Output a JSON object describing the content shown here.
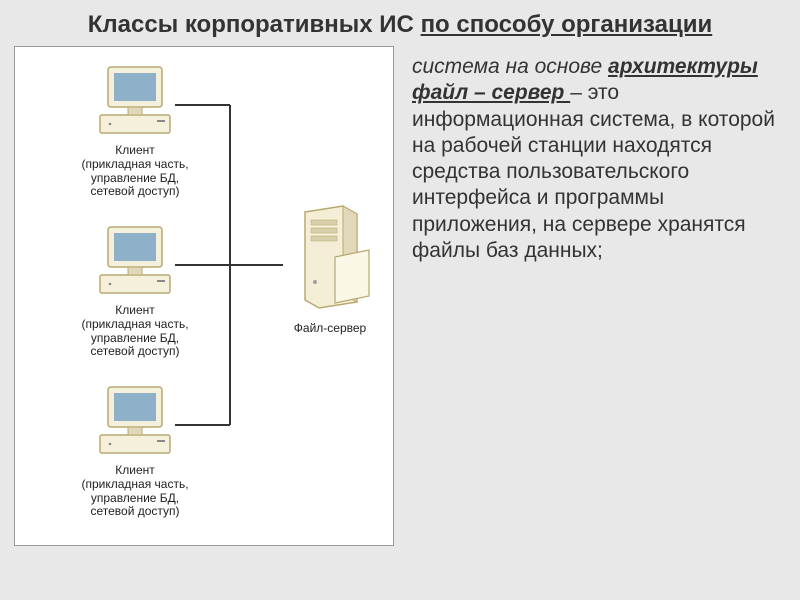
{
  "title": {
    "part1": "Классы корпоративных ИС ",
    "part2_underline": "по способу организации"
  },
  "text": {
    "intro_italic": "система на основе ",
    "arch_bold_underline": "архитектуры файл – сервер ",
    "body": "– это информационная система, в которой на рабочей станции находятся средства пользовательского интерфейса и программы приложения, на сервере хранятся файлы баз данных;"
  },
  "diagram": {
    "clients": [
      {
        "label_line1": "Клиент",
        "label_line2": "(прикладная часть,",
        "label_line3": "управление БД,",
        "label_line4": "сетевой доступ)"
      },
      {
        "label_line1": "Клиент",
        "label_line2": "(прикладная часть,",
        "label_line3": "управление БД,",
        "label_line4": "сетевой доступ)"
      },
      {
        "label_line1": "Клиент",
        "label_line2": "(прикладная часть,",
        "label_line3": "управление БД,",
        "label_line4": "сетевой доступ)"
      }
    ],
    "server": {
      "label": "Файл-сервер"
    }
  }
}
